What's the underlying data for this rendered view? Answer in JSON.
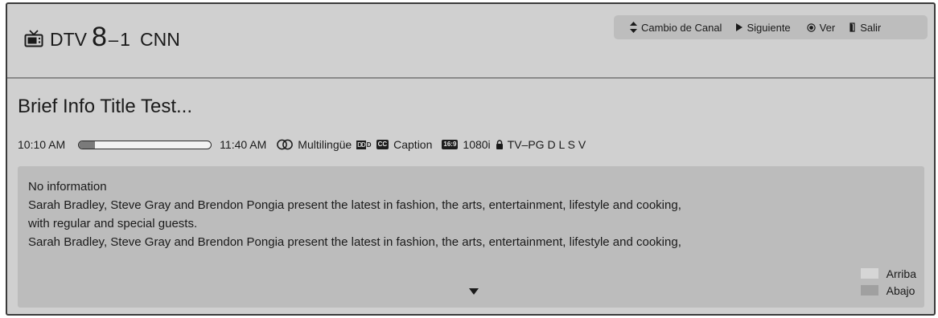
{
  "header": {
    "source": "DTV",
    "channel_major": "8",
    "channel_separator": "–",
    "channel_minor": "1",
    "channel_name": "CNN",
    "icon": "tv-icon"
  },
  "help_bar": {
    "items": [
      {
        "icon": "up-down-arrows-icon",
        "label": "Cambio de Canal"
      },
      {
        "icon": "play-arrow-icon",
        "label": "Siguiente"
      },
      {
        "icon": "ok-circle-icon",
        "label": "Ver"
      },
      {
        "icon": "exit-icon",
        "label": "Salir"
      }
    ]
  },
  "program": {
    "title": "Brief Info Title Test...",
    "start_time": "10:10 AM",
    "end_time": "11:40 AM",
    "progress": 0.12,
    "audio": "Multilingüe",
    "dolby_badge": "DD",
    "cc_badge": "CC",
    "caption": "Caption",
    "aspect_badge": "16:9",
    "resolution": "1080i",
    "rating": "TV–PG D L S V"
  },
  "description": {
    "lines": [
      "No information",
      "Sarah Bradley, Steve Gray and Brendon Pongia present the latest in fashion, the arts, entertainment, lifestyle and cooking,",
      "with regular and special guests.",
      "Sarah Bradley, Steve Gray and Brendon Pongia present the latest in fashion, the arts, entertainment, lifestyle and cooking,"
    ]
  },
  "legend": {
    "up_label": "Arriba",
    "down_label": "Abajo",
    "up_color": "#d6d6d6",
    "down_color": "#a0a0a0"
  },
  "colors": {
    "panel_bg": "#d0d0d0",
    "desc_bg": "#bcbcbc",
    "help_bg": "#bdbdbd",
    "text": "#1a1a1a"
  }
}
